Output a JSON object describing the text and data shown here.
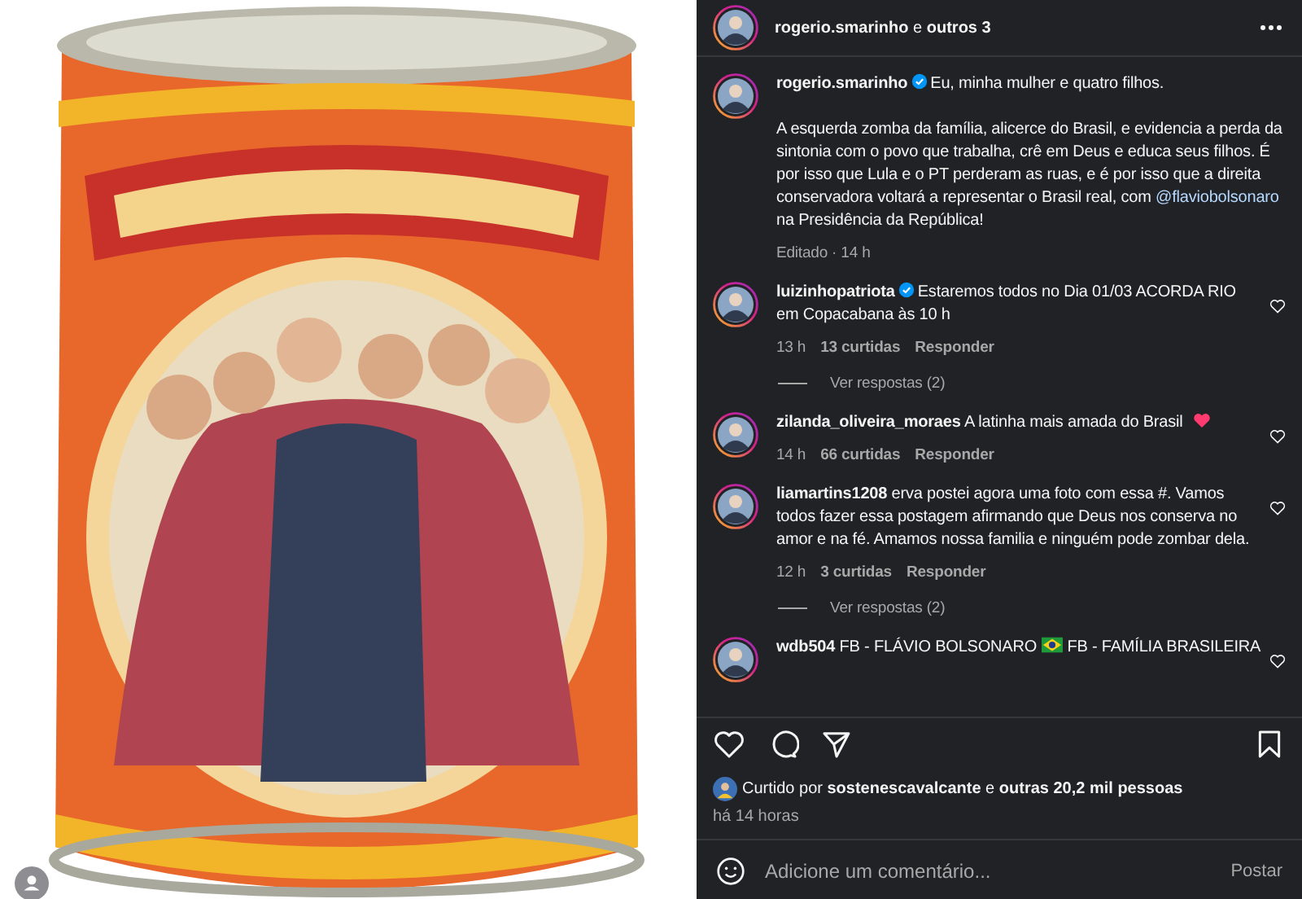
{
  "header": {
    "username": "rogerio.smarinho",
    "connector": "e",
    "others": "outros 3"
  },
  "caption": {
    "username": "rogerio.smarinho",
    "verified": true,
    "first_line": "Eu, minha mulher e quatro filhos.",
    "body_before": "A esquerda zomba da família, alicerce do Brasil, e evidencia a perda da sintonia com o povo que trabalha, crê em Deus e educa seus filhos. É por isso que Lula e o PT perderam as ruas, e é por isso que a direita conservadora voltará a representar o Brasil real, com ",
    "mention": "@flaviobolsonaro",
    "body_after": " na Presidência da República!",
    "meta": "Editado · 14 h"
  },
  "comments": [
    {
      "username": "luizinhopatriota",
      "verified": true,
      "segments": [
        {
          "kind": "text",
          "text": "Estaremos todos no Dia 01/03 ACORDA RIO em Copacabana às 10 h"
        }
      ],
      "time": "13 h",
      "likes": "13 curtidas",
      "reply": "Responder",
      "replies": "Ver respostas (2)",
      "liked": false
    },
    {
      "username": "zilanda_oliveira_moraes",
      "verified": false,
      "segments": [
        {
          "kind": "text",
          "text": "A latinha mais amada do Brasil"
        },
        {
          "kind": "heart"
        }
      ],
      "time": "14 h",
      "likes": "66 curtidas",
      "reply": "Responder",
      "liked": false
    },
    {
      "username": "liamartins1208",
      "verified": false,
      "segments": [
        {
          "kind": "text",
          "text": "erva postei agora uma foto com essa #. Vamos todos fazer essa postagem afirmando que Deus nos conserva no amor e na fé. Amamos nossa familia e ninguém pode zombar dela."
        }
      ],
      "time": "12 h",
      "likes": "3 curtidas",
      "reply": "Responder",
      "replies": "Ver respostas (2)",
      "liked": false
    },
    {
      "username": "wdb504",
      "verified": false,
      "segments": [
        {
          "kind": "text",
          "text": "FB - FLÁVIO BOLSONARO"
        },
        {
          "kind": "flag"
        },
        {
          "kind": "text",
          "text": "FB - FAMÍLIA BRASILEIRA"
        }
      ],
      "liked": false
    }
  ],
  "actions": {
    "liked": false,
    "saved": false
  },
  "likes": {
    "prefix": "Curtido por",
    "user": "sostenescavalcante",
    "connector": "e",
    "rest": "outras 20,2 mil pessoas"
  },
  "time": "há 14 horas",
  "comment_field": {
    "placeholder": "Adicione um comentário...",
    "button": "Postar"
  }
}
